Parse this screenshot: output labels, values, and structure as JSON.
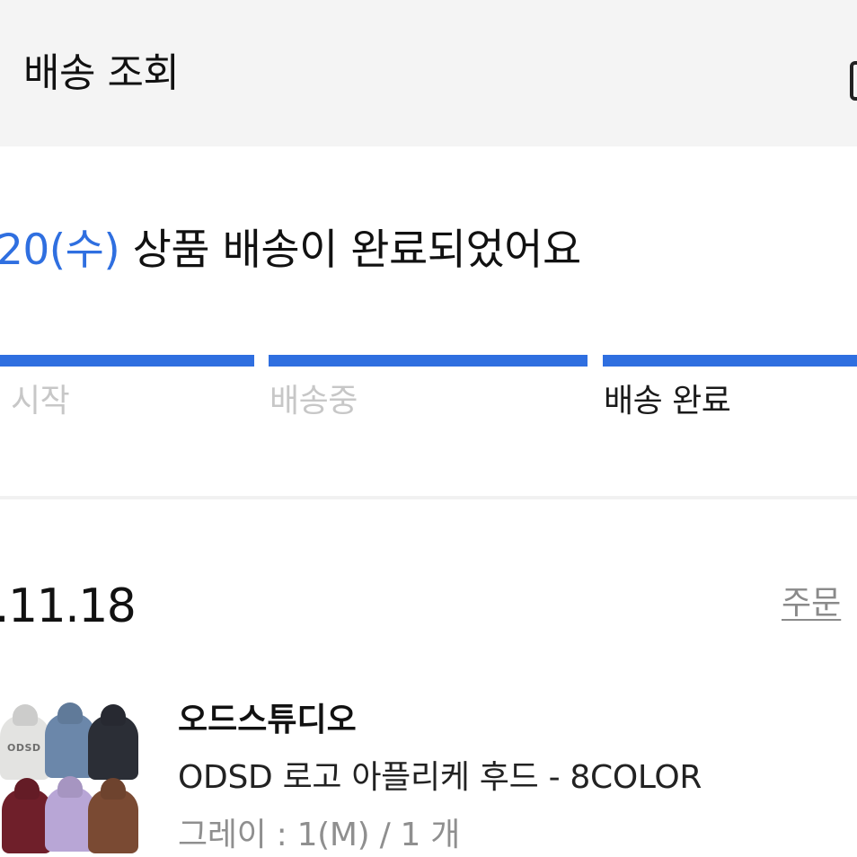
{
  "header": {
    "title": "배송 조회"
  },
  "status": {
    "date": "20(수)",
    "message": "상품 배송이 완료되었어요",
    "accent_color": "#2f6fe0"
  },
  "steps": [
    {
      "label": "시작",
      "state": "done"
    },
    {
      "label": "배송중",
      "state": "done"
    },
    {
      "label": "배송 완료",
      "state": "current"
    }
  ],
  "order": {
    "date": ".11.18",
    "detail_link": "주문"
  },
  "product": {
    "brand": "오드스튜디오",
    "name": "ODSD 로고 아플리케 후드 - 8COLOR",
    "option": "그레이 : 1(M) / 1 개",
    "thumbnail_logo_text": "ODSD"
  }
}
